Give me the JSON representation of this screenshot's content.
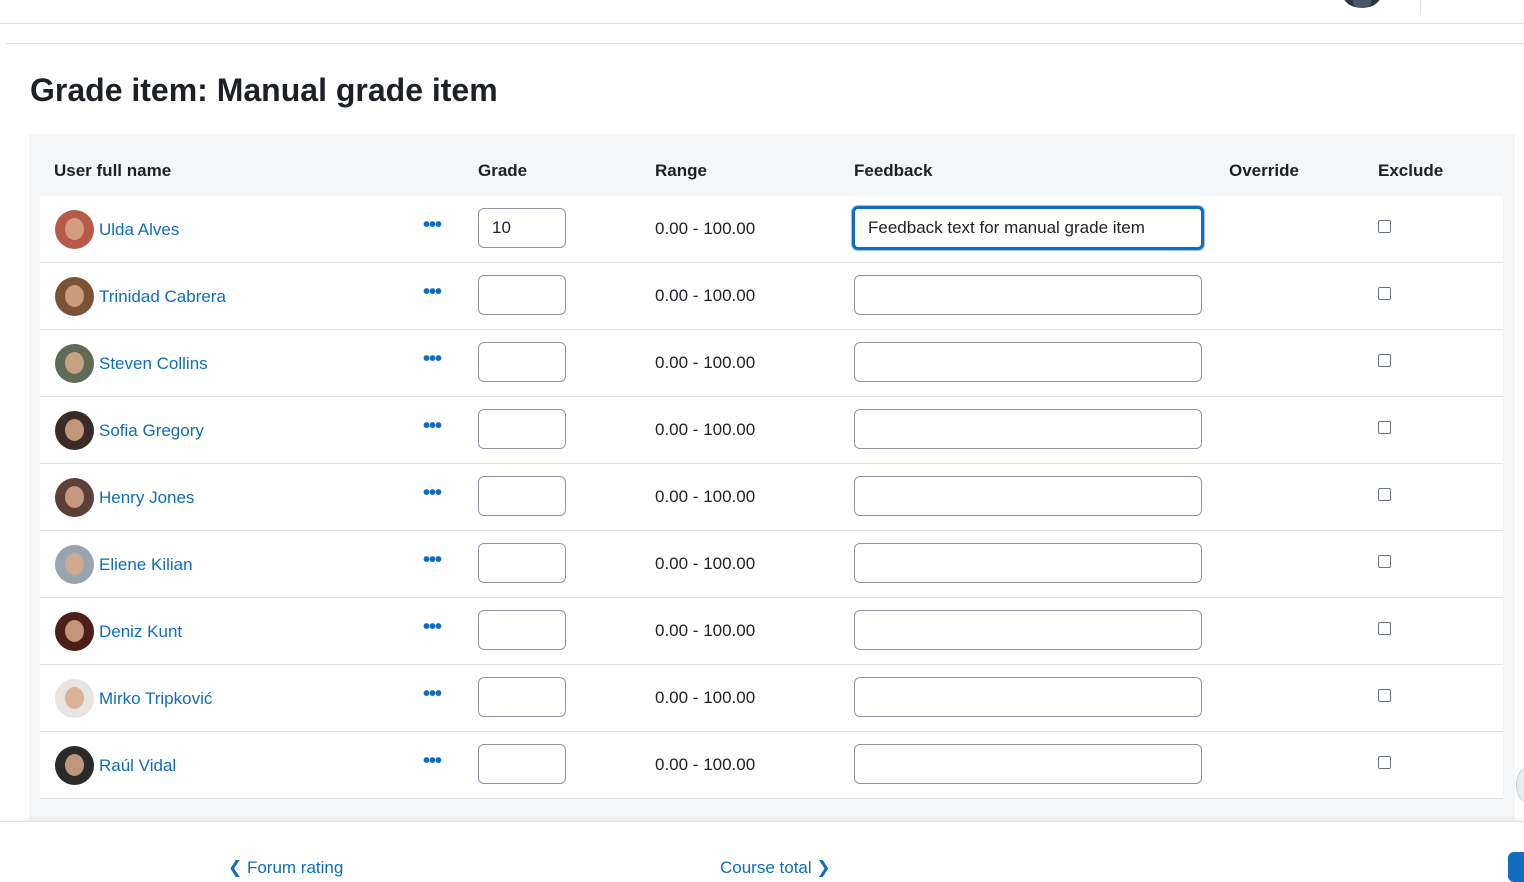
{
  "page": {
    "title": "Grade item: Manual grade item"
  },
  "table": {
    "headers": {
      "user": "User full name",
      "grade": "Grade",
      "range": "Range",
      "feedback": "Feedback",
      "override": "Override",
      "exclude": "Exclude"
    },
    "rows": [
      {
        "name": "Ulda Alves",
        "grade": "10",
        "range": "0.00 - 100.00",
        "feedback": "Feedback text for manual grade item",
        "avatar_color": "#b85a4a"
      },
      {
        "name": "Trinidad Cabrera",
        "grade": "",
        "range": "0.00 - 100.00",
        "feedback": "",
        "avatar_color": "#7a5236"
      },
      {
        "name": "Steven Collins",
        "grade": "",
        "range": "0.00 - 100.00",
        "feedback": "",
        "avatar_color": "#5f6b54"
      },
      {
        "name": "Sofia Gregory",
        "grade": "",
        "range": "0.00 - 100.00",
        "feedback": "",
        "avatar_color": "#3a2a28"
      },
      {
        "name": "Henry Jones",
        "grade": "",
        "range": "0.00 - 100.00",
        "feedback": "",
        "avatar_color": "#5b3f38"
      },
      {
        "name": "Eliene Kilian",
        "grade": "",
        "range": "0.00 - 100.00",
        "feedback": "",
        "avatar_color": "#9aa3b0"
      },
      {
        "name": "Deniz Kunt",
        "grade": "",
        "range": "0.00 - 100.00",
        "feedback": "",
        "avatar_color": "#4a2018"
      },
      {
        "name": "Mirko Tripković",
        "grade": "",
        "range": "0.00 - 100.00",
        "feedback": "",
        "avatar_color": "#e8e4e2"
      },
      {
        "name": "Raúl Vidal",
        "grade": "",
        "range": "0.00 - 100.00",
        "feedback": "",
        "avatar_color": "#2a2a2a"
      }
    ]
  },
  "footer": {
    "prev_label": "Forum rating",
    "next_label": "Course total"
  },
  "colors": {
    "link": "#0f6cbf",
    "focus": "#0f6cbf"
  }
}
